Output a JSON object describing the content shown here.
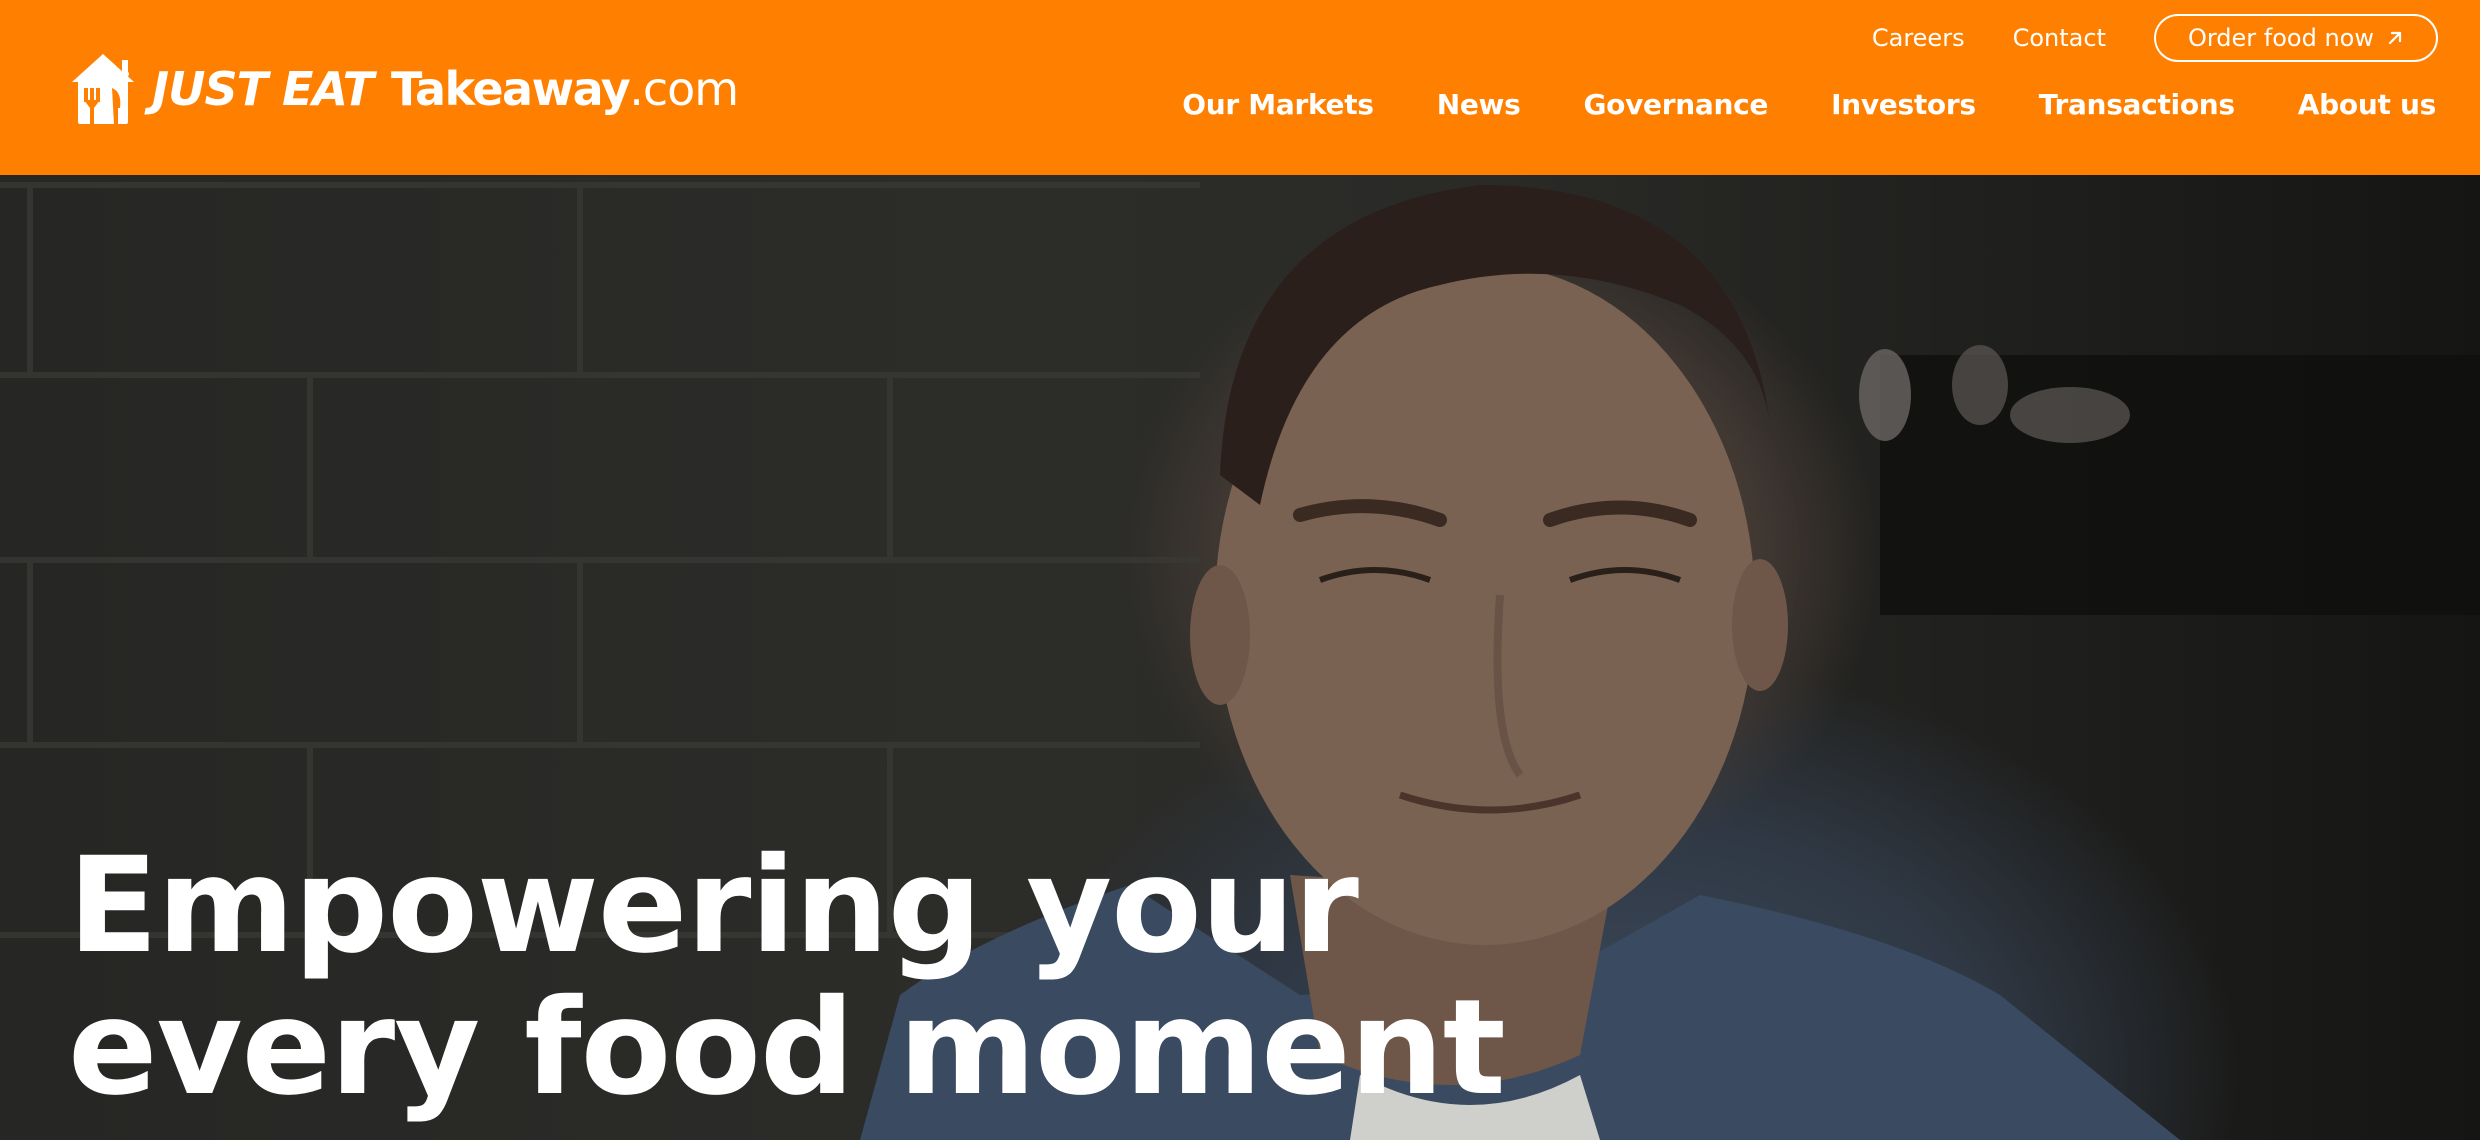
{
  "brand": {
    "just_eat": "JUST EAT",
    "takeaway": "Takeaway",
    "com": ".com",
    "color": "#ff8000"
  },
  "top_links": {
    "careers": "Careers",
    "contact": "Contact",
    "order": "Order food now",
    "order_icon": "arrow-up-right-icon"
  },
  "nav": {
    "items": [
      {
        "label": "Our Markets"
      },
      {
        "label": "News"
      },
      {
        "label": "Governance"
      },
      {
        "label": "Investors"
      },
      {
        "label": "Transactions"
      },
      {
        "label": "About us"
      }
    ]
  },
  "hero": {
    "line1": "Empowering your",
    "line2": "every food moment"
  }
}
